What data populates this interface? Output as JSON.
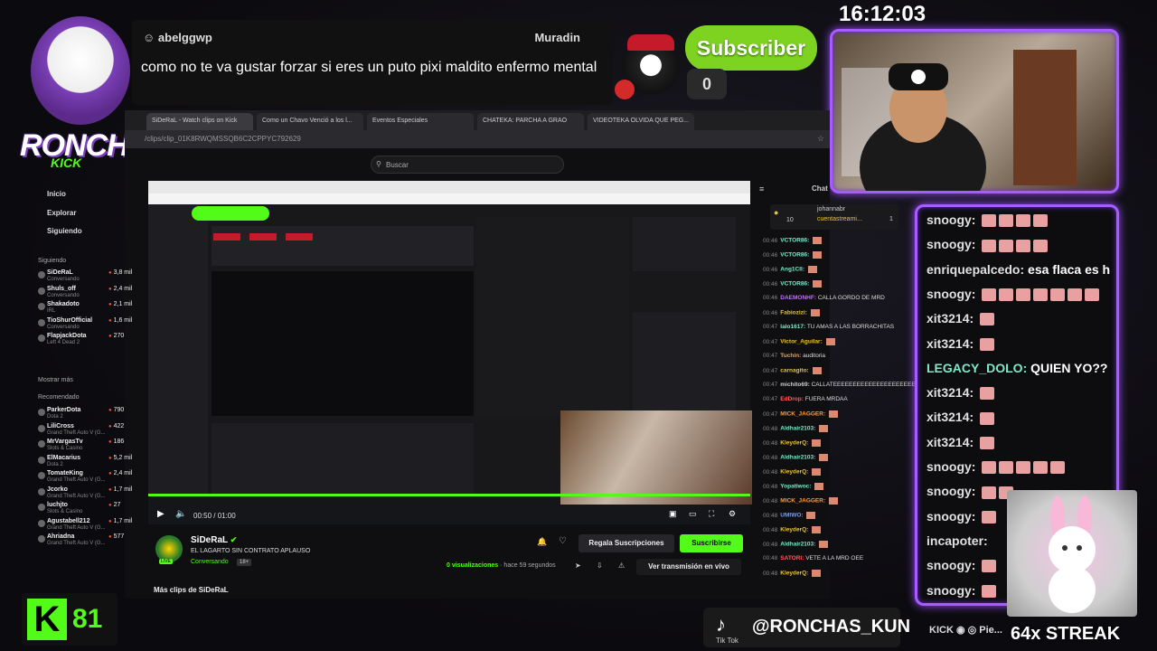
{
  "overlay": {
    "streamer_logo_text": "RONCHAS",
    "clock": "16:12:03",
    "alert": {
      "username": "abelggwp",
      "recipient": "Muradin",
      "message": "como no te va gustar forzar si eres un puto pixi maldito enfermo mental"
    },
    "subscriber_label": "Subscriber",
    "subscriber_count": "0",
    "kick_label": "K",
    "kick_count": "81",
    "tiktok_handle": "@RONCHAS_KUN",
    "tiktok_label": "Tik Tok",
    "social_text": "KICK ◉ ◎ Pie...",
    "streak_text": "64x STREAK",
    "chat_lines": [
      {
        "name": "snoogy:",
        "color": "#e0e0e0",
        "text": "",
        "emotes": 4
      },
      {
        "name": "snoogy:",
        "color": "#e0e0e0",
        "text": "",
        "emotes": 4
      },
      {
        "name": "enriquepalcedo:",
        "color": "#e0e0e0",
        "text": "esa flaca es h",
        "emotes": 0
      },
      {
        "name": "snoogy:",
        "color": "#e0e0e0",
        "text": "",
        "emotes": 7
      },
      {
        "name": "xit3214:",
        "color": "#e0e0e0",
        "text": "",
        "emotes": 1
      },
      {
        "name": "xit3214:",
        "color": "#e0e0e0",
        "text": "",
        "emotes": 1
      },
      {
        "name": "LEGACY_DOLO:",
        "color": "#7ee9c8",
        "text": "QUIEN YO??",
        "emotes": 0
      },
      {
        "name": "xit3214:",
        "color": "#e0e0e0",
        "text": "",
        "emotes": 1
      },
      {
        "name": "xit3214:",
        "color": "#e0e0e0",
        "text": "",
        "emotes": 1
      },
      {
        "name": "xit3214:",
        "color": "#e0e0e0",
        "text": "",
        "emotes": 1
      },
      {
        "name": "snoogy:",
        "color": "#e0e0e0",
        "text": "",
        "emotes": 5
      },
      {
        "name": "snoogy:",
        "color": "#e0e0e0",
        "text": "",
        "emotes": 2
      },
      {
        "name": "snoogy:",
        "color": "#e0e0e0",
        "text": "",
        "emotes": 1
      },
      {
        "name": "incapoter:",
        "color": "#e0e0e0",
        "text": "",
        "emotes": 0
      },
      {
        "name": "snoogy:",
        "color": "#e0e0e0",
        "text": "",
        "emotes": 1
      },
      {
        "name": "snoogy:",
        "color": "#e0e0e0",
        "text": "",
        "emotes": 1
      }
    ]
  },
  "browser": {
    "tabs": [
      "SiDeRaL - Watch clips on Kick",
      "Como un Chavo Venció a los l...",
      "Eventos Especiales",
      "CHATEKA: PARCHA A GRAO",
      "VIDEOTEKA OLVIDA QUE PEG..."
    ],
    "url": "/clips/clip_01K8RWQMSSQB6C2CPPYC792629",
    "search_placeholder": "Buscar",
    "nav": [
      "Inicio",
      "Explorar",
      "Siguiendo"
    ],
    "following_label": "Siguiendo",
    "following": [
      {
        "name": "SiDeRaL",
        "sub": "Conversando",
        "count": "3,8 mil"
      },
      {
        "name": "Shuls_off",
        "sub": "Conversando",
        "count": "2,4 mil"
      },
      {
        "name": "Shakadoto",
        "sub": "IRL",
        "count": "2,1 mil"
      },
      {
        "name": "TioShurOfficial",
        "sub": "Conversando",
        "count": "1,6 mil"
      },
      {
        "name": "FlapjackDota",
        "sub": "Left 4 Dead 2",
        "count": "270"
      }
    ],
    "show_more": "Mostrar más",
    "recommended_label": "Recomendado",
    "recommended": [
      {
        "name": "ParkerDota",
        "sub": "Dota 2",
        "count": "790"
      },
      {
        "name": "LiliCross",
        "sub": "Grand Theft Auto V (G...",
        "count": "422"
      },
      {
        "name": "MrVargasTv",
        "sub": "Slots & Casino",
        "count": "186"
      },
      {
        "name": "ElMacarius",
        "sub": "Dota 2",
        "count": "5,2 mil"
      },
      {
        "name": "TomateKing",
        "sub": "Grand Theft Auto V (G...",
        "count": "2,4 mil"
      },
      {
        "name": "Jcorko",
        "sub": "Grand Theft Auto V (G...",
        "count": "1,7 mil"
      },
      {
        "name": "luchjto",
        "sub": "Slots & Casino",
        "count": "27"
      },
      {
        "name": "Agustabell212",
        "sub": "Grand Theft Auto V (G...",
        "count": "1,7 mil"
      },
      {
        "name": "Ahriadna",
        "sub": "Grand Theft Auto V (G...",
        "count": "577"
      }
    ],
    "video_time": "00:50 / 01:00",
    "clip": {
      "channel": "SiDeRaL",
      "title": "EL LAGARTO SIN CONTRATO APLAUSO",
      "category": "Conversando",
      "rating": "18+",
      "views": "0 visualizaciones",
      "ago": "· hace 59 segundos",
      "gift_label": "Regala Suscripciones",
      "subscribe_label": "Suscribirse",
      "watch_live_label": "Ver transmisión en vivo",
      "more_clips": "Más clips de SiDeRaL",
      "live_badge": "LIVE"
    },
    "chat_title": "Chat",
    "pinned": {
      "user1": "johannabr",
      "count1": "10",
      "user2": "cuentastreami...",
      "count2": "1"
    },
    "chat": [
      {
        "t": "00:46",
        "n": "VCTOR86:",
        "c": "#7ee9c8",
        "m": "",
        "e": 1
      },
      {
        "t": "00:46",
        "n": "VCTOR86:",
        "c": "#7ee9c8",
        "m": "",
        "e": 1
      },
      {
        "t": "00:46",
        "n": "Ang1Cll:",
        "c": "#7ee9c8",
        "m": "",
        "e": 1
      },
      {
        "t": "00:46",
        "n": "VCTOR86:",
        "c": "#7ee9c8",
        "m": "",
        "e": 1
      },
      {
        "t": "00:46",
        "n": "DAEMONHF:",
        "c": "#c76bff",
        "m": "CALLA GORDO DE MRD",
        "e": 0
      },
      {
        "t": "00:46",
        "n": "Fabiozizi:",
        "c": "#e7c23b",
        "m": "",
        "e": 1
      },
      {
        "t": "00:47",
        "n": "lalo1617:",
        "c": "#7ee9c8",
        "m": "TU AMAS A LAS BORRACHITAS",
        "e": 0
      },
      {
        "t": "00:47",
        "n": "Victor_Aguilar:",
        "c": "#e7c23b",
        "m": "",
        "e": 1
      },
      {
        "t": "00:47",
        "n": "Tuchin:",
        "c": "#ff9a3c",
        "m": "auditoria",
        "e": 0
      },
      {
        "t": "00:47",
        "n": "carnagito:",
        "c": "#e7c23b",
        "m": "",
        "e": 1
      },
      {
        "t": "00:47",
        "n": "michito69:",
        "c": "#cccccc",
        "m": "CALLATEEEEEEEEEEEEEEEEEEEEEE",
        "e": 0
      },
      {
        "t": "00:47",
        "n": "EdDrop:",
        "c": "#ff5a5a",
        "m": "FUERA MRDAA",
        "e": 0
      },
      {
        "t": "00:47",
        "n": "MICK_JAGGER:",
        "c": "#ff9a3c",
        "m": "",
        "e": 1
      },
      {
        "t": "00:48",
        "n": "Aldhair2103:",
        "c": "#7ee9c8",
        "m": "",
        "e": 1
      },
      {
        "t": "00:48",
        "n": "KleyderQ:",
        "c": "#e7c23b",
        "m": "",
        "e": 1
      },
      {
        "t": "00:48",
        "n": "Aldhair2103:",
        "c": "#7ee9c8",
        "m": "",
        "e": 1
      },
      {
        "t": "00:48",
        "n": "KleyderQ:",
        "c": "#e7c23b",
        "m": "",
        "e": 1
      },
      {
        "t": "00:48",
        "n": "Yopatiwoc:",
        "c": "#7ee9c8",
        "m": "",
        "e": 1
      },
      {
        "t": "00:48",
        "n": "MICK_JAGGER:",
        "c": "#ff9a3c",
        "m": "",
        "e": 1
      },
      {
        "t": "00:48",
        "n": "UMIWO:",
        "c": "#7e9ce9",
        "m": "",
        "e": 1
      },
      {
        "t": "00:48",
        "n": "KleyderQ:",
        "c": "#e7c23b",
        "m": "",
        "e": 1
      },
      {
        "t": "00:48",
        "n": "Aldhair2103:",
        "c": "#7ee9c8",
        "m": "",
        "e": 1
      },
      {
        "t": "00:48",
        "n": "SATORI:",
        "c": "#ff5a5a",
        "m": "VETE A LA MRD OEE",
        "e": 0
      },
      {
        "t": "00:48",
        "n": "KleyderQ:",
        "c": "#e7c23b",
        "m": "",
        "e": 1
      }
    ]
  },
  "colors": {
    "neon": "#a75cff",
    "kick_green": "#53fc18"
  }
}
